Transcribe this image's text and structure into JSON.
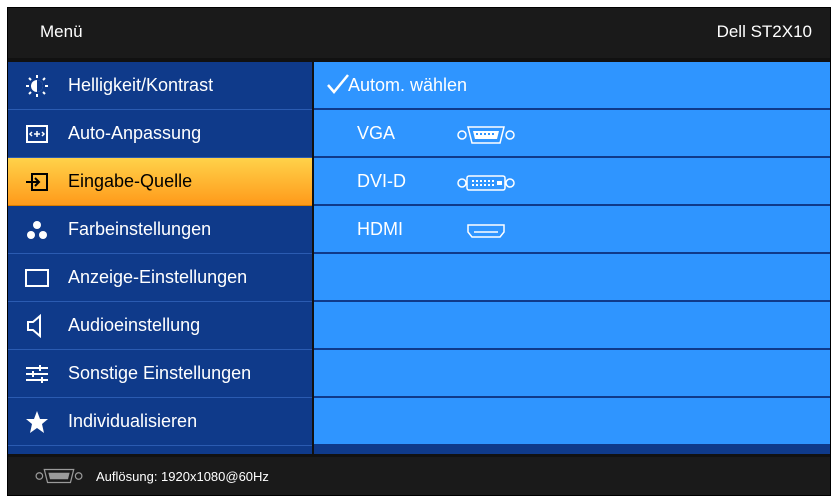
{
  "header": {
    "title": "Menü",
    "model": "Dell ST2X10"
  },
  "menu": {
    "items": [
      {
        "label": "Helligkeit/Kontrast",
        "icon": "brightness-icon"
      },
      {
        "label": "Auto-Anpassung",
        "icon": "auto-adjust-icon"
      },
      {
        "label": "Eingabe-Quelle",
        "icon": "input-source-icon",
        "selected": true
      },
      {
        "label": "Farbeinstellungen",
        "icon": "color-settings-icon"
      },
      {
        "label": "Anzeige-Einstellungen",
        "icon": "display-settings-icon"
      },
      {
        "label": "Audioeinstellung",
        "icon": "speaker-icon"
      },
      {
        "label": "Sonstige Einstellungen",
        "icon": "sliders-icon"
      },
      {
        "label": "Individualisieren",
        "icon": "star-icon"
      }
    ]
  },
  "sources": {
    "auto_select": "Autom. wählen",
    "options": [
      {
        "label": "VGA",
        "icon": "vga-connector-icon"
      },
      {
        "label": "DVI-D",
        "icon": "dvi-connector-icon"
      },
      {
        "label": "HDMI",
        "icon": "hdmi-connector-icon"
      }
    ]
  },
  "footer": {
    "resolution_text": "Auflösung: 1920x1080@60Hz",
    "icon": "vga-connector-icon"
  },
  "colors": {
    "panel_blue": "#0f3a8a",
    "row_blue": "#2f95ff",
    "selected_orange": "#ffb62e",
    "header_bg": "#1a1a1a"
  }
}
